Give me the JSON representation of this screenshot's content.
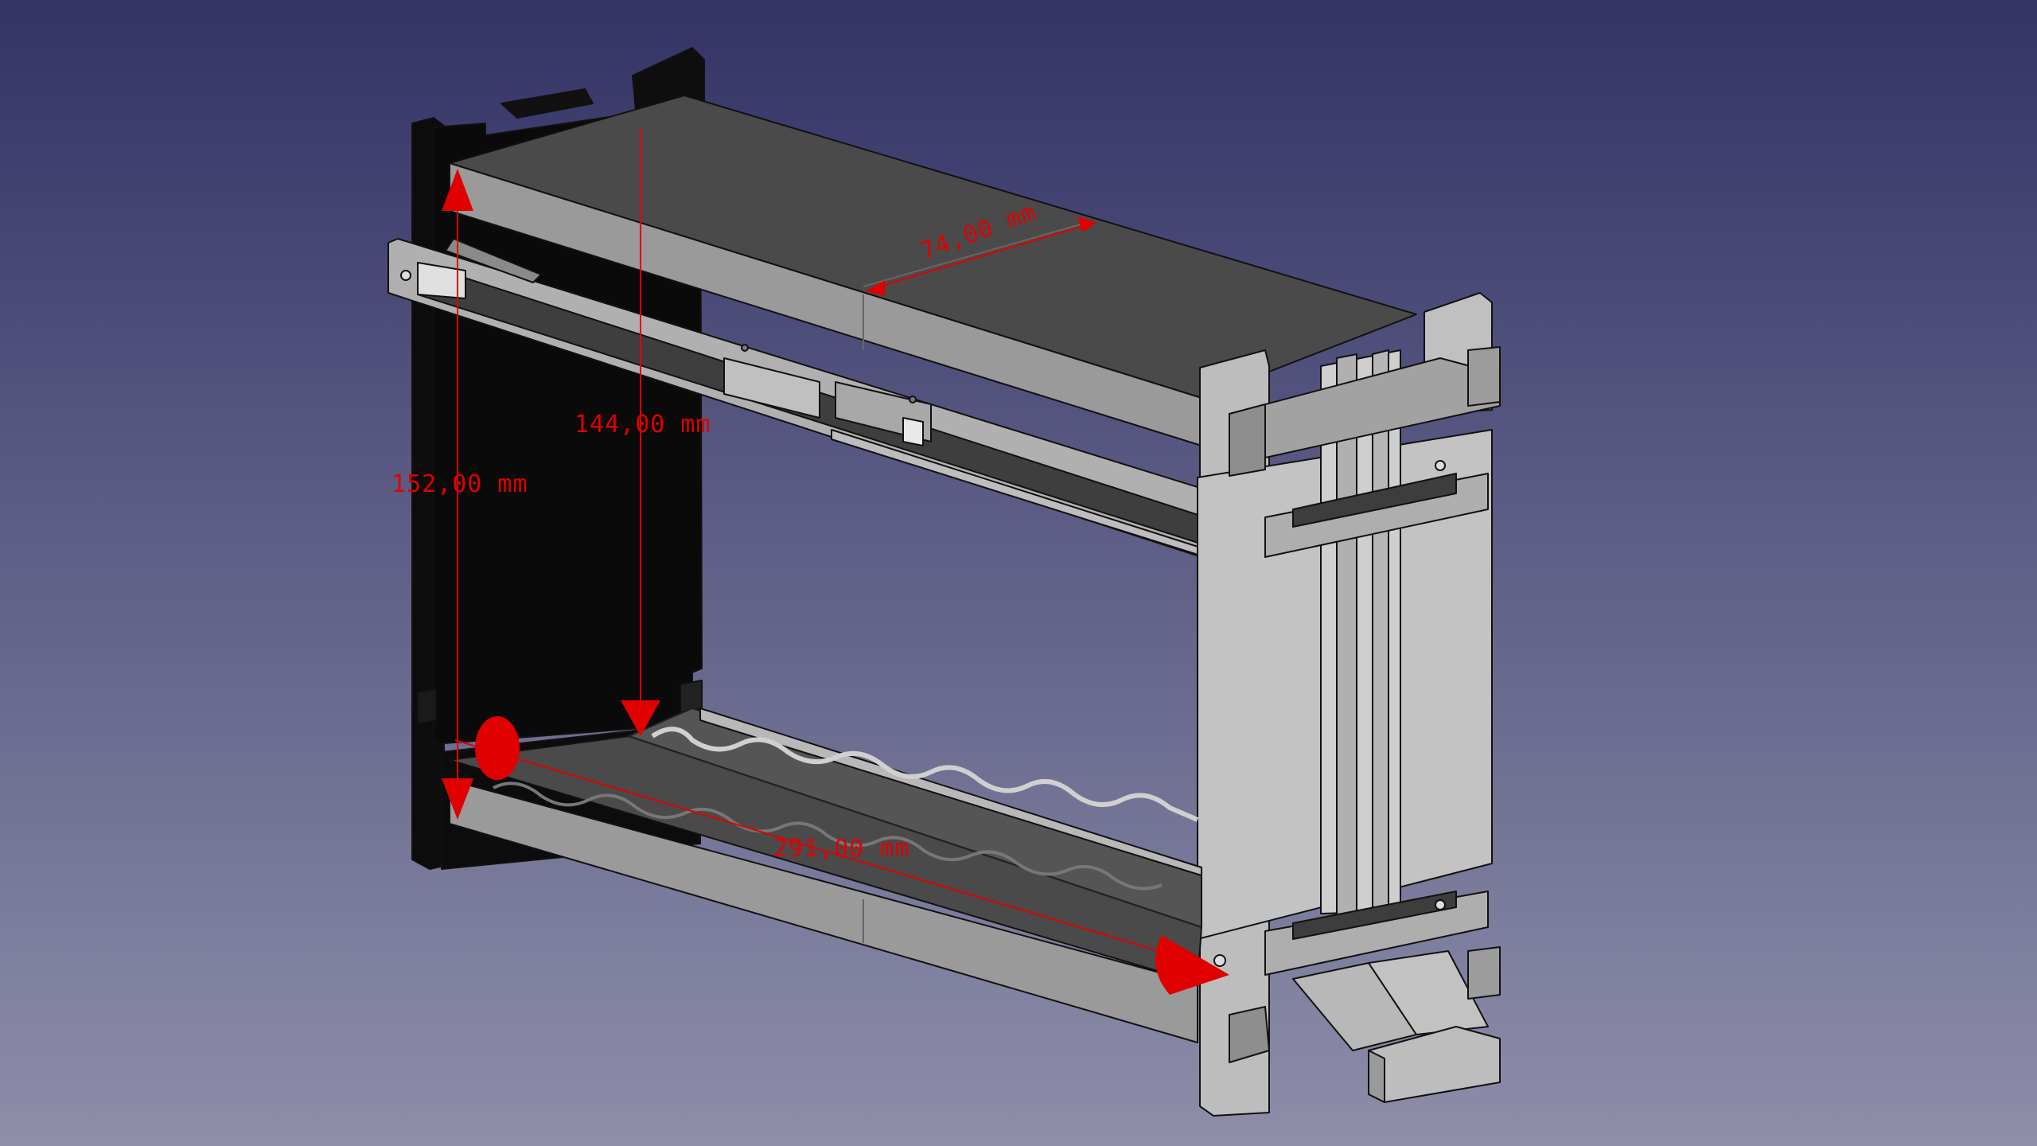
{
  "viewport": {
    "background_top": "#333366",
    "background_bottom": "#8e8eaa"
  },
  "model": {
    "dark_part_color": "#0c0c0c",
    "light_part_color": "#b4b4b4",
    "shade_color": "#484848",
    "outline_color": "#111111"
  },
  "dimensions": {
    "color": "#e00000",
    "depth_label": "74,00 mm",
    "inner_height_label": "144,00 mm",
    "outer_height_label": "152,00 mm",
    "length_label": "291,00 mm"
  }
}
